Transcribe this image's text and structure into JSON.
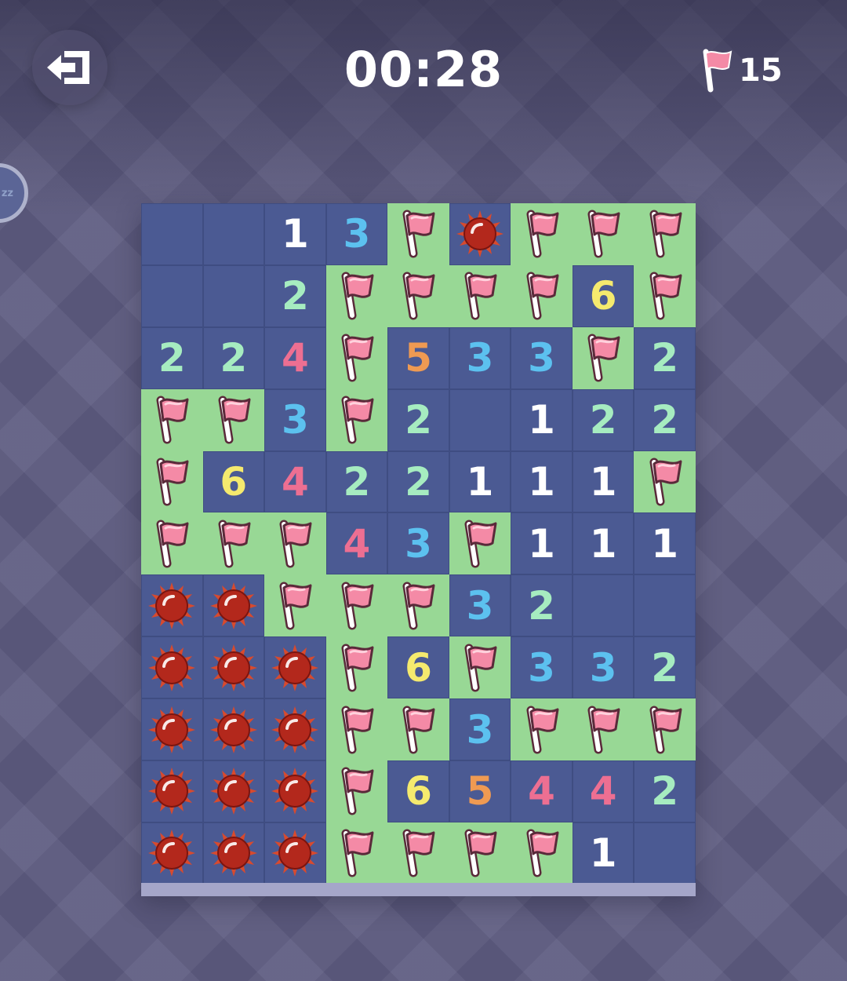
{
  "header": {
    "timer": "00:28",
    "flag_count": "15",
    "exit_icon": "exit-icon",
    "flag_icon": "flag-icon"
  },
  "colors": {
    "background": "#5e5c81",
    "revealed_tile": "#4b5a93",
    "covered_tile": "#98d895",
    "flag": "#f48aa6",
    "mine": "#b3281c",
    "n1": "#ffffff",
    "n2": "#a6ecc0",
    "n3": "#5cc1ef",
    "n4": "#ed6f92",
    "n5": "#ef9a52",
    "n6": "#f5ea6e"
  },
  "board": {
    "columns": 9,
    "rows": [
      [
        "",
        "",
        "1",
        "3",
        "F",
        "M",
        "F",
        "F",
        "F"
      ],
      [
        "",
        "",
        "2",
        "F",
        "F",
        "F",
        "F",
        "6",
        "F"
      ],
      [
        "2",
        "2",
        "4",
        "F",
        "5",
        "3",
        "3",
        "F",
        "2"
      ],
      [
        "F",
        "F",
        "3",
        "F",
        "2",
        "",
        "1",
        "2",
        "2"
      ],
      [
        "F",
        "6",
        "4",
        "2",
        "2",
        "1",
        "1",
        "1",
        "F"
      ],
      [
        "F",
        "F",
        "F",
        "4",
        "3",
        "F",
        "1",
        "1",
        "1"
      ],
      [
        "M",
        "M",
        "F",
        "F",
        "F",
        "3",
        "2",
        "",
        ""
      ],
      [
        "M",
        "M",
        "M",
        "F",
        "6",
        "F",
        "3",
        "3",
        "2"
      ],
      [
        "M",
        "M",
        "M",
        "F",
        "F",
        "3",
        "F",
        "F",
        "F"
      ],
      [
        "M",
        "M",
        "M",
        "F",
        "6",
        "5",
        "4",
        "4",
        "2"
      ],
      [
        "M",
        "M",
        "M",
        "F",
        "F",
        "F",
        "F",
        "1",
        ""
      ]
    ]
  }
}
